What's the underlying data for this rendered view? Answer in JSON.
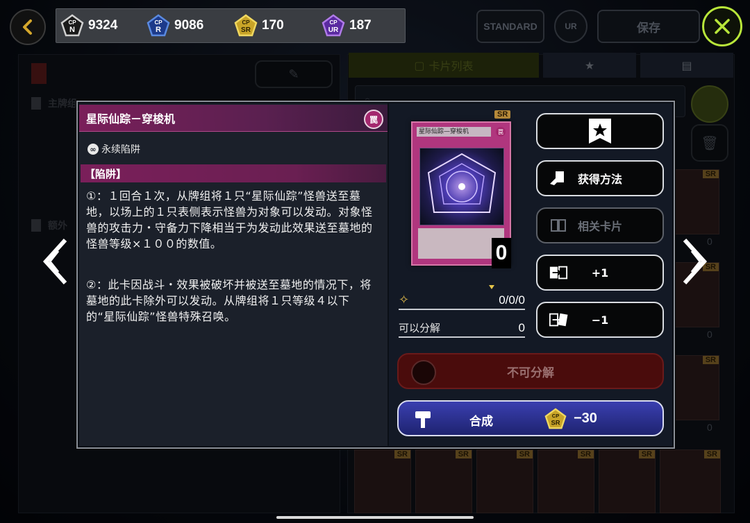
{
  "topbar": {
    "cp_points": [
      {
        "rarity": "N",
        "label": "CP N",
        "value": "9324",
        "color": "#d0d0d0"
      },
      {
        "rarity": "R",
        "label": "CP R",
        "value": "9086",
        "color": "#3b6fd1"
      },
      {
        "rarity": "SR",
        "label": "CP SR",
        "value": "170",
        "color": "#d8b838"
      },
      {
        "rarity": "UR",
        "label": "CP UR",
        "value": "187",
        "color": "#7a3ac8"
      }
    ],
    "standard_label": "STANDARD",
    "ur_label": "UR",
    "save_label": "保存"
  },
  "background": {
    "tab_card_list": "卡片列表",
    "main_deck_label": "主牌组",
    "extra_deck_label": "额外",
    "card_count_zero": "0"
  },
  "modal": {
    "card_name": "星际仙踪－穿梭机",
    "attribute_badge": "罠",
    "subtype": "永续陷阱",
    "category": "【陷阱】",
    "effect_1": "①：１回合１次，从牌组将１只“星际仙踪”怪兽送至墓地，以场上的１只表侧表示怪兽为对象可以发动。对象怪兽的攻击力・守备力下降相当于为发动此效果送至墓地的怪兽等级×１００的数值。",
    "effect_2": "②：此卡因战斗・效果被破坏并被送至墓地的情况下，将墓地的此卡除外可以发动。从牌组将１只等级４以下的“星际仙踪”怪兽特殊召唤。",
    "card_image_title": "星际仙踪—穿梭机",
    "card_image_attr": "罠",
    "rarity": "SR",
    "owned_count": "0",
    "copies_value": "0/0/0",
    "dismantle_label": "可以分解",
    "dismantle_count": "0",
    "buttons": {
      "how_to_get": "获得方法",
      "related_cards": "相关卡片",
      "add_one": "+1",
      "remove_one": "−1",
      "cannot_dismantle": "不可分解",
      "craft": "合成",
      "craft_cost": "−30",
      "craft_cost_rarity": "SR"
    }
  }
}
